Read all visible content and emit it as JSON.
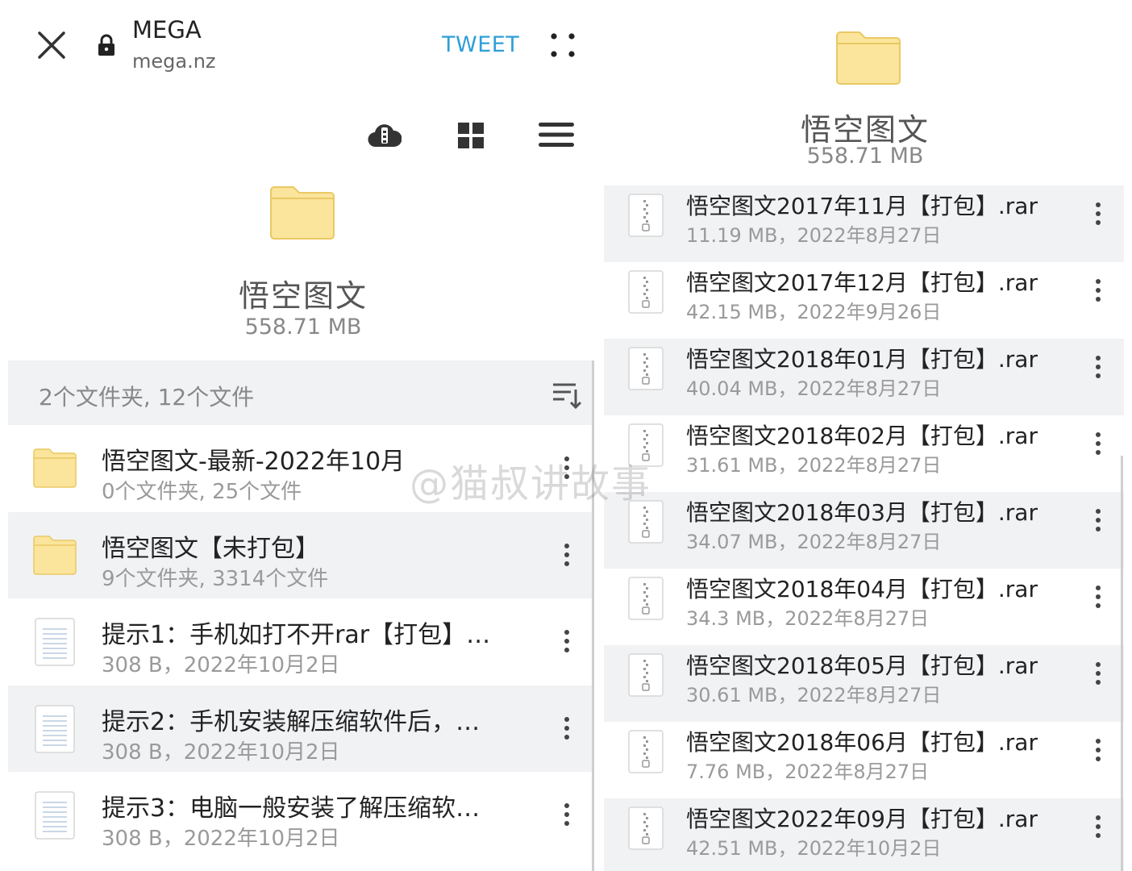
{
  "left": {
    "topbar": {
      "close_icon": "close-icon",
      "lock_icon": "lock-icon",
      "site_title": "MEGA",
      "site_url": "mega.nz",
      "tweet_label": "TWEET",
      "more_icon": "vertical-dots-icon"
    },
    "toolbar": {
      "cloud_icon": "cloud-download-icon",
      "grid_icon": "grid-view-icon",
      "menu_icon": "hamburger-menu-icon"
    },
    "folder": {
      "name": "悟空图文",
      "size": "558.71 MB"
    },
    "summary": "2个文件夹, 12个文件",
    "items": [
      {
        "type": "folder",
        "title": "悟空图文-最新-2022年10月",
        "sub": "0个文件夹, 25个文件",
        "shaded": false
      },
      {
        "type": "folder",
        "title": "悟空图文【未打包】",
        "sub": "9个文件夹, 3314个文件",
        "shaded": true
      },
      {
        "type": "doc",
        "title": "提示1：手机如打不开rar【打包】…",
        "sub": "308 B，2022年10月2日",
        "shaded": false
      },
      {
        "type": "doc",
        "title": "提示2：手机安装解压缩软件后，…",
        "sub": "308 B，2022年10月2日",
        "shaded": true
      },
      {
        "type": "doc",
        "title": "提示3：电脑一般安装了解压缩软…",
        "sub": "308 B，2022年10月2日",
        "shaded": false
      }
    ]
  },
  "right": {
    "folder": {
      "name": "悟空图文",
      "size": "558.71 MB"
    },
    "items": [
      {
        "title": "悟空图文2017年11月【打包】.rar",
        "sub": "11.19 MB，2022年8月27日",
        "shaded": true
      },
      {
        "title": "悟空图文2017年12月【打包】.rar",
        "sub": "42.15 MB，2022年9月26日",
        "shaded": false
      },
      {
        "title": "悟空图文2018年01月【打包】.rar",
        "sub": "40.04 MB，2022年8月27日",
        "shaded": true
      },
      {
        "title": "悟空图文2018年02月【打包】.rar",
        "sub": "31.61 MB，2022年8月27日",
        "shaded": false
      },
      {
        "title": "悟空图文2018年03月【打包】.rar",
        "sub": "34.07 MB，2022年8月27日",
        "shaded": true
      },
      {
        "title": "悟空图文2018年04月【打包】.rar",
        "sub": "34.3 MB，2022年8月27日",
        "shaded": false
      },
      {
        "title": "悟空图文2018年05月【打包】.rar",
        "sub": "30.61 MB，2022年8月27日",
        "shaded": true
      },
      {
        "title": "悟空图文2018年06月【打包】.rar",
        "sub": "7.76 MB，2022年8月27日",
        "shaded": false
      },
      {
        "title": "悟空图文2022年09月【打包】.rar",
        "sub": "42.51 MB，2022年10月2日",
        "shaded": true
      }
    ]
  },
  "watermark": "@猫叔讲故事",
  "colors": {
    "accent": "#2f9fd8",
    "folder_fill": "#fbe49b",
    "folder_stroke": "#e9c964",
    "row_shade": "#f1f2f4"
  }
}
